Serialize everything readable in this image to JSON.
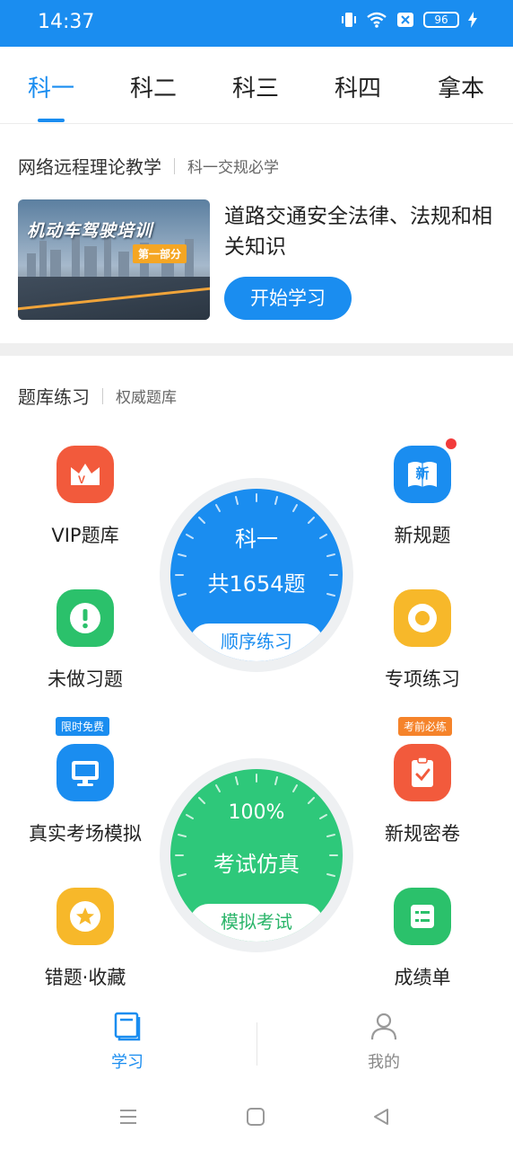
{
  "status": {
    "time": "14:37",
    "battery": "96"
  },
  "tabs": [
    {
      "label": "科一",
      "active": true
    },
    {
      "label": "科二",
      "active": false
    },
    {
      "label": "科三",
      "active": false
    },
    {
      "label": "科四",
      "active": false
    },
    {
      "label": "拿本",
      "active": false
    }
  ],
  "course": {
    "header_title": "网络远程理论教学",
    "header_sub": "科一交规必学",
    "banner_title": "机动车驾驶培训",
    "banner_badge": "第一部分",
    "title": "道路交通安全法律、法规和相关知识",
    "start_button": "开始学习"
  },
  "practice": {
    "header_title": "题库练习",
    "header_sub": "权威题库",
    "features": [
      {
        "label": "VIP题库",
        "icon": "crown-icon",
        "color": "#f25a3c"
      },
      {
        "label": "新规题",
        "icon": "book-new-icon",
        "color": "#1a8df0",
        "icon_text": "新"
      },
      {
        "label": "未做习题",
        "icon": "exclamation-icon",
        "color": "#2bc16b"
      },
      {
        "label": "专项练习",
        "icon": "target-icon",
        "color": "#f7b82a"
      },
      {
        "label": "真实考场模拟",
        "icon": "monitor-icon",
        "color": "#1a8df0",
        "tag": "限时免费"
      },
      {
        "label": "新规密卷",
        "icon": "clipboard-check-icon",
        "color": "#f25a3c",
        "tag": "考前必练"
      },
      {
        "label": "错题·收藏",
        "icon": "star-icon",
        "color": "#f7b82a"
      },
      {
        "label": "成绩单",
        "icon": "list-icon",
        "color": "#2bc16b"
      }
    ],
    "dial_order": {
      "line1": "科一",
      "line2": "共1654题",
      "button": "顺序练习",
      "color": "#1a8df0"
    },
    "dial_exam": {
      "line1": "100%",
      "line2": "考试仿真",
      "button": "模拟考试",
      "color": "#2ec87a"
    }
  },
  "bottom_nav": [
    {
      "label": "学习",
      "icon": "book-icon",
      "active": true
    },
    {
      "label": "我的",
      "icon": "user-icon",
      "active": false
    }
  ]
}
